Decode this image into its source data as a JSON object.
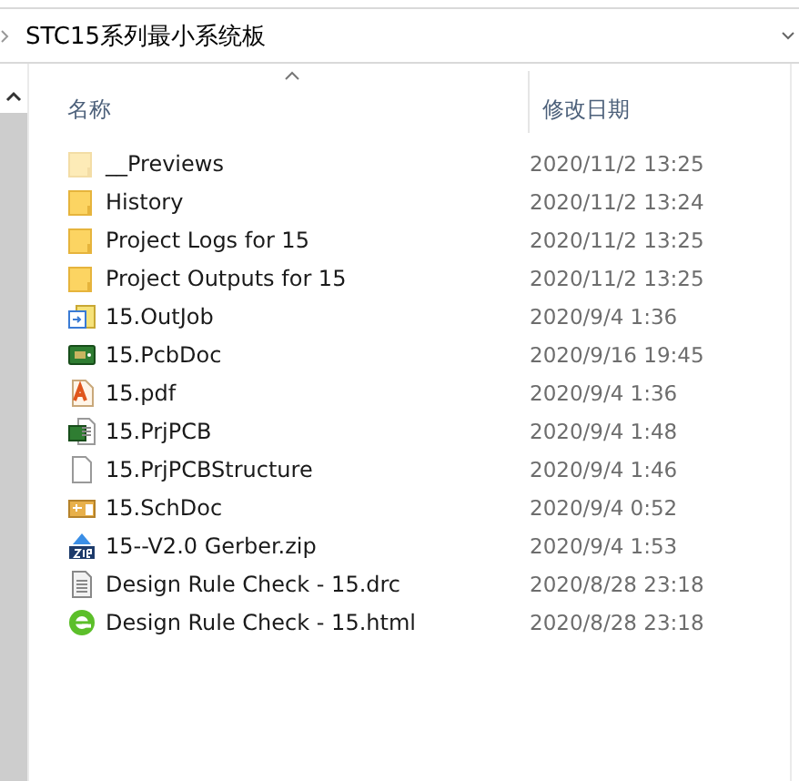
{
  "breadcrumb": {
    "path": "STC15系列最小系统板"
  },
  "columns": [
    {
      "label": "名称",
      "sorted": true
    },
    {
      "label": "修改日期",
      "sorted": false
    }
  ],
  "files": [
    {
      "name": "__Previews",
      "date": "2020/11/2 13:25",
      "kind": "folder",
      "hidden": true
    },
    {
      "name": "History",
      "date": "2020/11/2 13:24",
      "kind": "folder",
      "hidden": false
    },
    {
      "name": "Project Logs for 15",
      "date": "2020/11/2 13:25",
      "kind": "folder",
      "hidden": false
    },
    {
      "name": "Project Outputs for 15",
      "date": "2020/11/2 13:25",
      "kind": "folder",
      "hidden": false
    },
    {
      "name": "15.OutJob",
      "date": "2020/9/4 1:36",
      "kind": "outjob",
      "hidden": false
    },
    {
      "name": "15.PcbDoc",
      "date": "2020/9/16 19:45",
      "kind": "pcb",
      "hidden": false
    },
    {
      "name": "15.pdf",
      "date": "2020/9/4 1:36",
      "kind": "pdf",
      "hidden": false
    },
    {
      "name": "15.PrjPCB",
      "date": "2020/9/4 1:48",
      "kind": "project",
      "hidden": false
    },
    {
      "name": "15.PrjPCBStructure",
      "date": "2020/9/4 1:46",
      "kind": "blank",
      "hidden": false
    },
    {
      "name": "15.SchDoc",
      "date": "2020/9/4 0:52",
      "kind": "schematic",
      "hidden": false
    },
    {
      "name": "15--V2.0 Gerber.zip",
      "date": "2020/9/4 1:53",
      "kind": "zip",
      "hidden": false
    },
    {
      "name": "Design Rule Check - 15.drc",
      "date": "2020/8/28 23:18",
      "kind": "text",
      "hidden": false
    },
    {
      "name": "Design Rule Check - 15.html",
      "date": "2020/8/28 23:18",
      "kind": "web",
      "hidden": false
    }
  ]
}
